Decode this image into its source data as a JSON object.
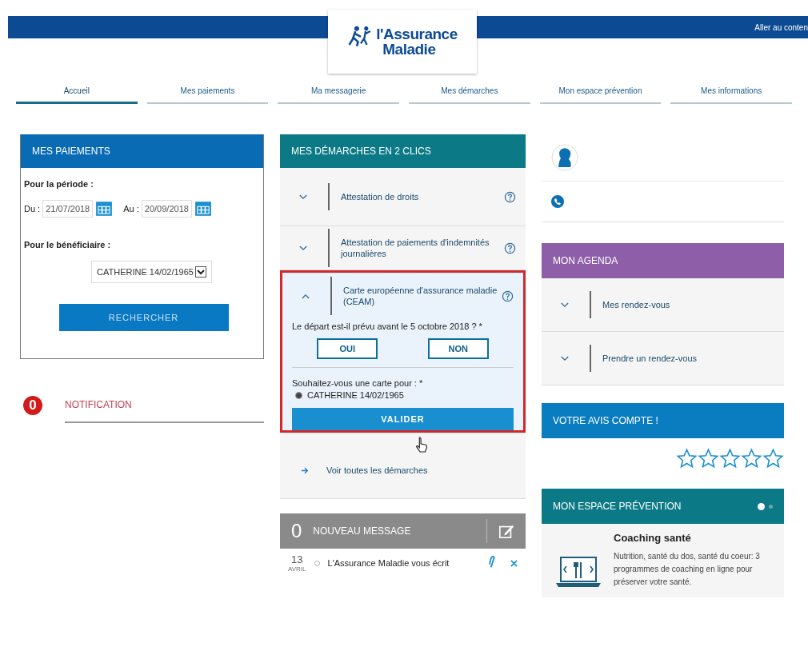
{
  "header": {
    "skip_link": "Aller au conten",
    "logo_lines": [
      "l'Assurance",
      "Maladie"
    ]
  },
  "nav": [
    {
      "label": "Accueil",
      "selected": true
    },
    {
      "label": "Mes paiements",
      "selected": false
    },
    {
      "label": "Ma messagerie",
      "selected": false
    },
    {
      "label": "Mes démarches",
      "selected": false
    },
    {
      "label": "Mon espace prévention",
      "selected": false
    },
    {
      "label": "Mes informations",
      "selected": false
    }
  ],
  "payments": {
    "title": "MES PAIEMENTS",
    "period_label": "Pour la période :",
    "from_label": "Du :",
    "from_value": "21/07/2018",
    "to_label": "Au :",
    "to_value": "20/09/2018",
    "beneficiary_label": "Pour le bénéficiaire :",
    "beneficiary_value": "CATHERINE 14/02/1965",
    "search_button": "RECHERCHER"
  },
  "notification": {
    "count": "0",
    "label": "NOTIFICATION"
  },
  "procedures": {
    "title": "MES DÉMARCHES EN 2 CLICS",
    "items": [
      {
        "label": "Attestation de droits",
        "expanded": false,
        "highlighted": false
      },
      {
        "label": "Attestation de paiements d'indemnités journalières",
        "expanded": false,
        "highlighted": false
      },
      {
        "label": "Carte européenne d'assurance maladie (CEAM)",
        "expanded": true,
        "highlighted": true,
        "question": "Le départ est-il prévu avant le 5 octobre 2018 ? *",
        "options": [
          "OUI",
          "NON"
        ],
        "card_question": "Souhaitez-vous une carte pour : *",
        "recipients": [
          {
            "label": "CATHERINE 14/02/1965",
            "selected": true
          }
        ],
        "submit": "VALIDER"
      }
    ],
    "see_all": "Voir toutes les démarches"
  },
  "messages": {
    "count": "0",
    "title": "NOUVEAU MESSAGE",
    "items": [
      {
        "day": "13",
        "month": "AVRIL",
        "sender": "L'Assurance Maladie vous écrit",
        "read": false,
        "attachment": true
      }
    ]
  },
  "agenda": {
    "title": "MON AGENDA",
    "items": [
      {
        "label": "Mes rendez-vous",
        "expanded": false
      },
      {
        "label": "Prendre un rendez-vous",
        "expanded": false
      }
    ]
  },
  "feedback": {
    "title": "VOTRE AVIS COMPTE !",
    "stars": 0
  },
  "prevention": {
    "title": "MON ESPACE PRÉVENTION",
    "pages": [
      {
        "selected": true
      },
      {
        "selected": false
      }
    ],
    "card_title": "Coaching santé",
    "card_text": "Nutrition, santé du dos, santé du coeur: 3 programmes de coaching en ligne pour préserver votre santé."
  }
}
